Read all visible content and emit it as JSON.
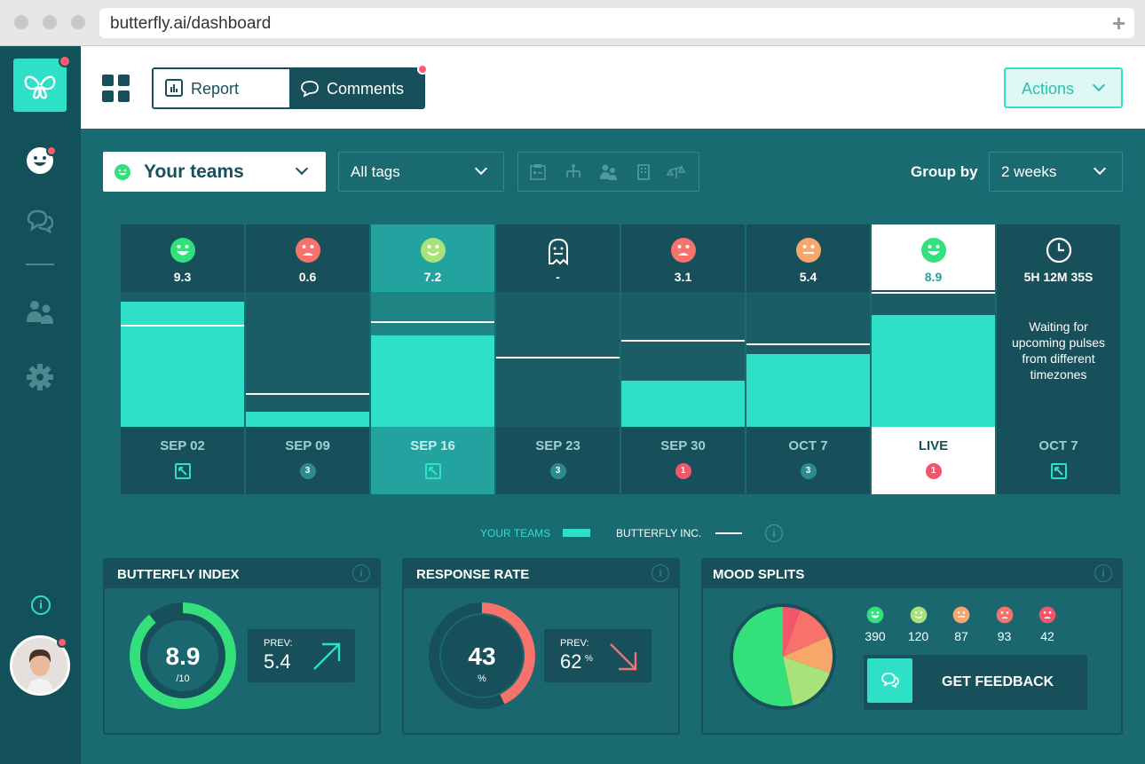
{
  "browser": {
    "url": "butterfly.ai/dashboard"
  },
  "topbar": {
    "report_label": "Report",
    "comments_label": "Comments",
    "actions_label": "Actions"
  },
  "filters": {
    "teams_label": "Your teams",
    "tags_label": "All tags",
    "group_by_label": "Group by",
    "group_by_value": "2 weeks",
    "tag_icons": [
      "clipboard-icon",
      "org-chart-icon",
      "people-icon",
      "building-icon",
      "scale-icon"
    ]
  },
  "chart": {
    "columns": [
      {
        "score": "9.3",
        "date": "SEP 02",
        "mood": "happy",
        "bar": 0.93,
        "bench": 0.75,
        "badge": null
      },
      {
        "score": "0.6",
        "date": "SEP 09",
        "mood": "sad",
        "bar": 0.11,
        "bench": 0.24,
        "badge": "3"
      },
      {
        "score": "7.2",
        "date": "SEP 16",
        "mood": "happy-light",
        "bar": 0.68,
        "bench": 0.78,
        "badge": null
      },
      {
        "score": "-",
        "date": "SEP 23",
        "mood": "ghost",
        "bar": 0,
        "bench": 0.51,
        "badge": "3"
      },
      {
        "score": "3.1",
        "date": "SEP 30",
        "mood": "sad",
        "bar": 0.34,
        "bench": 0.64,
        "badge": "1"
      },
      {
        "score": "5.4",
        "date": "OCT 7",
        "mood": "neutral",
        "bar": 0.54,
        "bench": 0.61,
        "badge": "3"
      },
      {
        "score": "8.9",
        "date": "LIVE",
        "mood": "happy",
        "bar": 0.83,
        "bench": 1.0,
        "badge": "1"
      },
      {
        "score": "5H 12M 35S",
        "date": "OCT 7",
        "mood": "clock",
        "bar": 0,
        "bench": null,
        "badge": null
      }
    ],
    "waiting_text": "Waiting for upcoming pulses from different timezones"
  },
  "legend": {
    "your_teams": "YOUR TEAMS",
    "butterfly_inc": "BUTTERFLY INC."
  },
  "cards": {
    "index": {
      "title": "BUTTERFLY INDEX",
      "value": "8.9",
      "unit": "/10",
      "progress": 0.89,
      "prev_label": "PREV:",
      "prev_value": "5.4"
    },
    "response": {
      "title": "RESPONSE RATE",
      "value": "43",
      "unit": "%",
      "progress": 0.43,
      "prev_label": "PREV:",
      "prev_value": "62",
      "prev_unit": "%"
    },
    "mood": {
      "title": "MOOD SPLITS",
      "counts": [
        "390",
        "120",
        "87",
        "93",
        "42"
      ],
      "feedback_label": "GET FEEDBACK"
    }
  },
  "colors": {
    "accent": "#2ee0c8",
    "dark": "#17505a",
    "happy": "#33e07c",
    "happy_light": "#a8e37a",
    "neutral": "#f9a66b",
    "sad": "#f7726a",
    "very_sad": "#f3556c"
  }
}
